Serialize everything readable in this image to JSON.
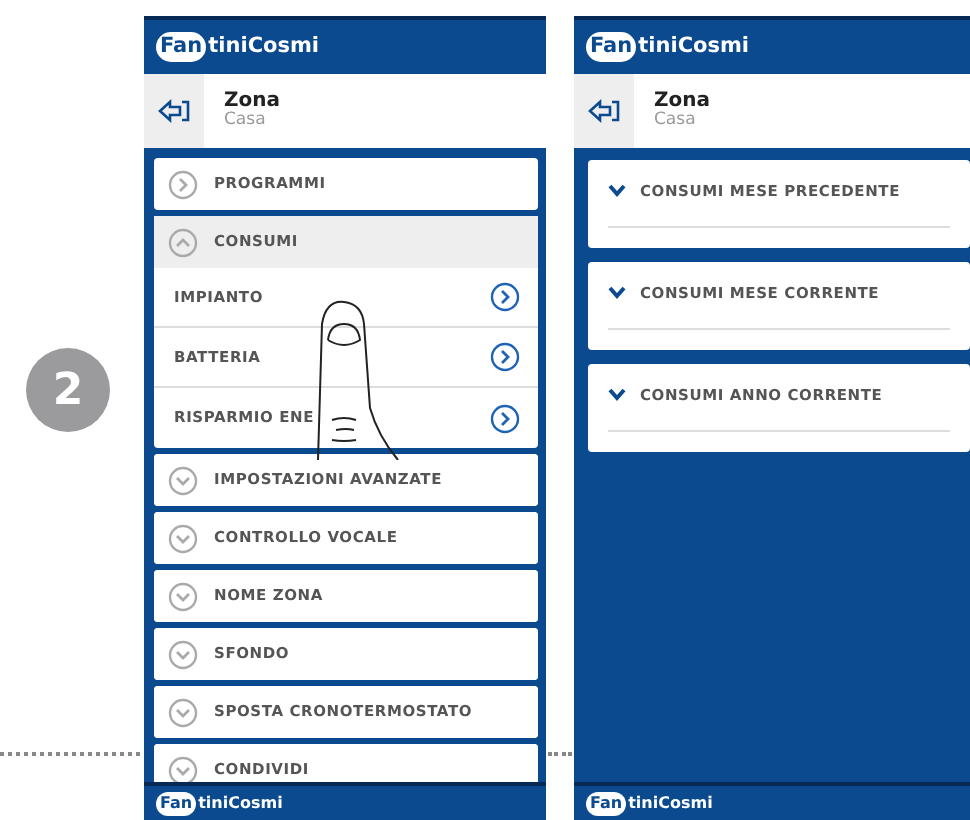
{
  "step_badge": "2",
  "screens": [
    {
      "logo": {
        "mark": "Fan",
        "rest": "tiniCosmi"
      },
      "zone": {
        "title": "Zona",
        "subtitle": "Casa"
      },
      "menu": [
        {
          "kind": "link",
          "label": "PROGRAMMI"
        },
        {
          "kind": "expander",
          "label": "CONSUMI",
          "expanded": true,
          "children": [
            {
              "label": "IMPIANTO"
            },
            {
              "label": "BATTERIA"
            },
            {
              "label": "RISPARMIO ENE"
            }
          ]
        },
        {
          "kind": "expander",
          "label": "IMPOSTAZIONI AVANZATE",
          "expanded": false
        },
        {
          "kind": "expander",
          "label": "CONTROLLO VOCALE",
          "expanded": false
        },
        {
          "kind": "expander",
          "label": "NOME ZONA",
          "expanded": false
        },
        {
          "kind": "expander",
          "label": "SFONDO",
          "expanded": false
        },
        {
          "kind": "expander",
          "label": "SPOSTA CRONOTERMOSTATO",
          "expanded": false
        },
        {
          "kind": "expander",
          "label": "CONDIVIDI",
          "expanded": false
        }
      ],
      "next_logo": {
        "mark": "Fan",
        "rest": "tiniCosmi"
      }
    },
    {
      "logo": {
        "mark": "Fan",
        "rest": "tiniCosmi"
      },
      "zone": {
        "title": "Zona",
        "subtitle": "Casa"
      },
      "sections": [
        {
          "label": "CONSUMI MESE PRECEDENTE"
        },
        {
          "label": "CONSUMI MESE CORRENTE"
        },
        {
          "label": "CONSUMI ANNO CORRENTE"
        }
      ],
      "next_logo": {
        "mark": "Fan",
        "rest": "tiniCosmi"
      }
    }
  ]
}
